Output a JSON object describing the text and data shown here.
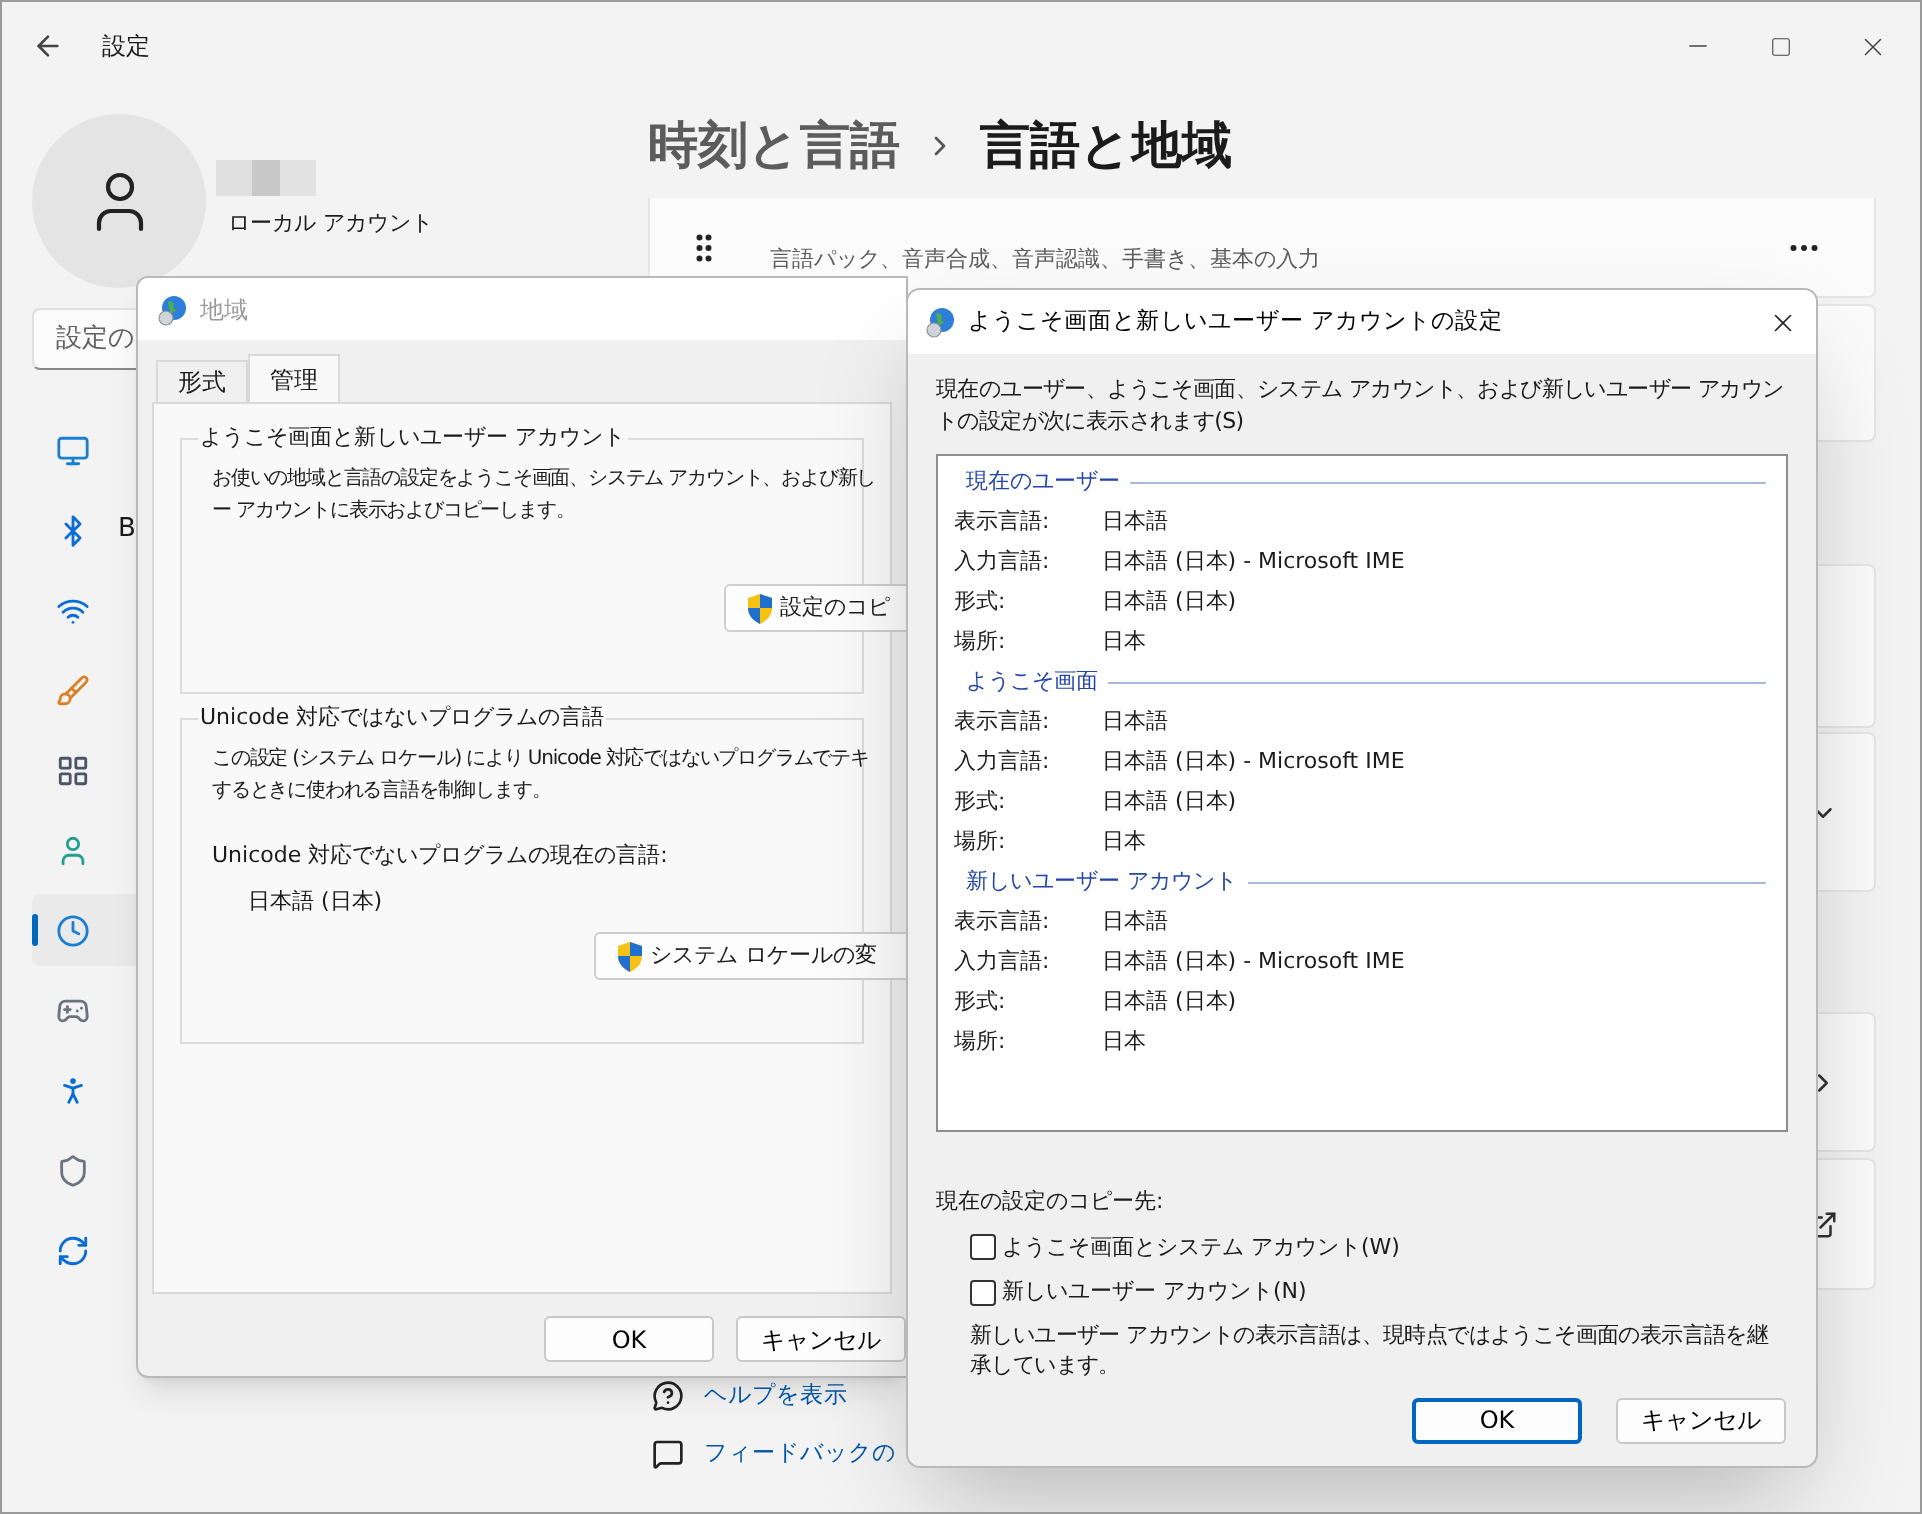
{
  "window": {
    "title": "設定"
  },
  "account": {
    "type": "ローカル アカウント"
  },
  "search": {
    "placeholder": "設定の"
  },
  "sidebar": {
    "items": [
      {
        "kind": "system",
        "selected": false
      },
      {
        "label": "B",
        "kind": "bluetooth",
        "selected": false
      },
      {
        "kind": "network",
        "selected": false
      },
      {
        "kind": "personalization",
        "selected": false
      },
      {
        "kind": "apps",
        "selected": false
      },
      {
        "kind": "accounts",
        "selected": false
      },
      {
        "kind": "time",
        "selected": true
      },
      {
        "kind": "gaming",
        "selected": false
      },
      {
        "kind": "accessibility",
        "selected": false
      },
      {
        "kind": "privacy",
        "selected": false
      },
      {
        "kind": "update",
        "selected": false
      }
    ]
  },
  "breadcrumb": [
    "時刻と言語",
    "言語と地域"
  ],
  "language_card": {
    "description": "言語パック、音声合成、音声認識、手書き、基本の入力"
  },
  "links": [
    {
      "label": "ヘルプを表示",
      "kind": "help"
    },
    {
      "label": "フィードバックの",
      "kind": "feedback"
    }
  ],
  "region_dialog": {
    "title": "地域",
    "active": false,
    "tabs": [
      {
        "label": "形式",
        "selected": false
      },
      {
        "label": "管理",
        "selected": true
      }
    ],
    "groups": [
      {
        "title": "ようこそ画面と新しいユーザー アカウント",
        "lines": [
          "お使いの地域と言語の設定をようこそ画面、システム アカウント、および新し",
          "ー アカウントに表示およびコピーします。"
        ],
        "button": "設定のコピ"
      },
      {
        "title": "Unicode 対応ではないプログラムの言語",
        "lines": [
          "この設定 (システム ロケール) により Unicode 対応ではないプログラムでテキ",
          "するときに使われる言語を制御します。"
        ],
        "current_label": "Unicode 対応でないプログラムの現在の言語:",
        "current_value": "日本語 (日本)",
        "button": "システム ロケールの変"
      }
    ],
    "buttons": [
      "OK",
      "キャンセル"
    ]
  },
  "welcome_dialog": {
    "title": "ようこそ画面と新しいユーザー アカウントの設定",
    "active": true,
    "description": "現在のユーザー、ようこそ画面、システム アカウント、および新しいユーザー アカウントの設定が次に表示されます(S)",
    "sections": [
      {
        "title": "現在のユーザー",
        "rows": [
          {
            "label": "表示言語:",
            "value": "日本語"
          },
          {
            "label": "入力言語:",
            "value": "日本語 (日本) - Microsoft IME"
          },
          {
            "label": "形式:",
            "value": "日本語 (日本)"
          },
          {
            "label": "場所:",
            "value": "日本"
          }
        ]
      },
      {
        "title": "ようこそ画面",
        "rows": [
          {
            "label": "表示言語:",
            "value": "日本語"
          },
          {
            "label": "入力言語:",
            "value": "日本語 (日本) - Microsoft IME"
          },
          {
            "label": "形式:",
            "value": "日本語 (日本)"
          },
          {
            "label": "場所:",
            "value": "日本"
          }
        ]
      },
      {
        "title": "新しいユーザー アカウント",
        "rows": [
          {
            "label": "表示言語:",
            "value": "日本語"
          },
          {
            "label": "入力言語:",
            "value": "日本語 (日本) - Microsoft IME"
          },
          {
            "label": "形式:",
            "value": "日本語 (日本)"
          },
          {
            "label": "場所:",
            "value": "日本"
          }
        ]
      }
    ],
    "copy_label": "現在の設定のコピー先:",
    "checkboxes": [
      {
        "label": "ようこそ画面とシステム アカウント(W)",
        "checked": false
      },
      {
        "label": "新しいユーザー アカウント(N)",
        "checked": false
      }
    ],
    "note": "新しいユーザー アカウントの表示言語は、現時点ではようこそ画面の表示言語を継承しています。",
    "buttons": [
      {
        "label": "OK",
        "default": true
      },
      {
        "label": "キャンセル",
        "default": false
      }
    ]
  }
}
